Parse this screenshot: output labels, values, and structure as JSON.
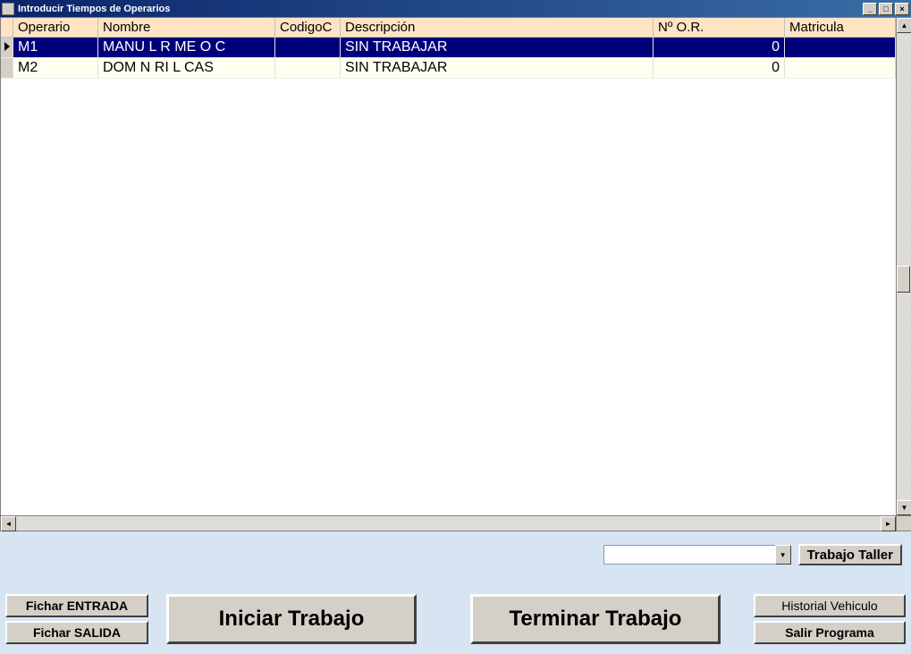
{
  "window": {
    "title": "Introducir Tiempos de Operarios"
  },
  "grid": {
    "columns": {
      "operario": "Operario",
      "nombre": "Nombre",
      "codigoc": "CodigoC",
      "descripcion": "Descripción",
      "n_or": "Nº O.R.",
      "matricula": "Matricula"
    },
    "rows": [
      {
        "selected": true,
        "operario": "M1",
        "nombre": "MANU  L R   ME  O C",
        "codigoc": "",
        "descripcion": "SIN TRABAJAR",
        "n_or": "0",
        "matricula": ""
      },
      {
        "selected": false,
        "operario": "M2",
        "nombre": "DOM N      RI  L CAS",
        "codigoc": "",
        "descripcion": "SIN TRABAJAR",
        "n_or": "0",
        "matricula": ""
      }
    ]
  },
  "combo": {
    "value": ""
  },
  "buttons": {
    "trabajo_taller": "Trabajo Taller",
    "fichar_entrada": "Fichar ENTRADA",
    "fichar_salida": "Fichar SALIDA",
    "iniciar_trabajo": "Iniciar Trabajo",
    "terminar_trabajo": "Terminar Trabajo",
    "historial_vehiculo": "Historial Vehiculo",
    "salir_programa": "Salir Programa"
  }
}
